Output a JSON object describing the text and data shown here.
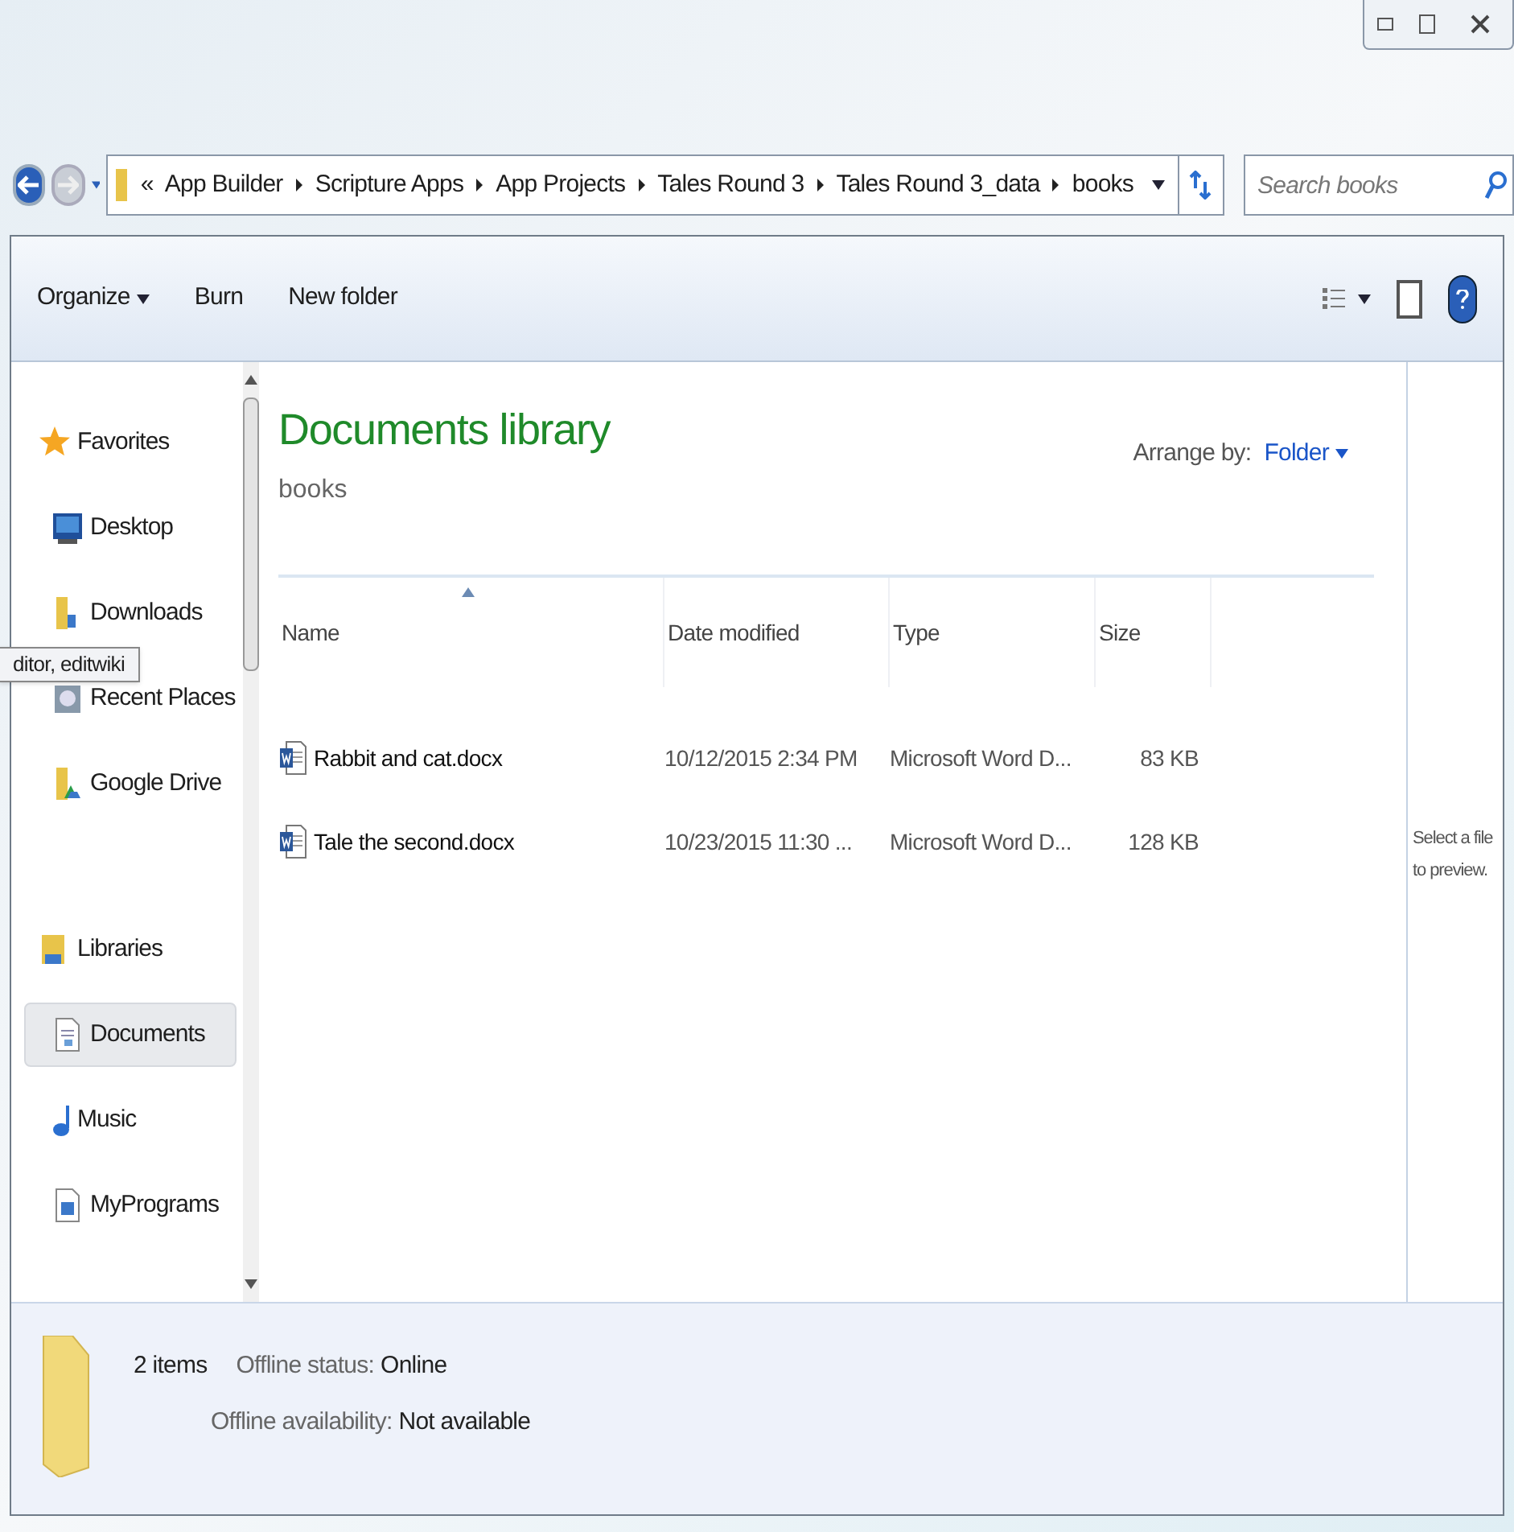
{
  "address_bar": {
    "overflow": "«",
    "segments": [
      "App Builder",
      "Scripture Apps",
      "App Projects",
      "Tales Round 3",
      "Tales Round 3_data",
      "books"
    ]
  },
  "search": {
    "placeholder": "Search books"
  },
  "toolbar": {
    "buttons": [
      {
        "label": "Organize",
        "dropdown": true
      },
      {
        "label": "Burn",
        "dropdown": false
      },
      {
        "label": "New folder",
        "dropdown": false
      }
    ]
  },
  "sidebar": {
    "items": [
      {
        "label": "Favorites",
        "kind": "group",
        "selected": false
      },
      {
        "label": "Desktop",
        "kind": "item",
        "selected": false
      },
      {
        "label": "Downloads",
        "kind": "item",
        "selected": false
      },
      {
        "label": "Recent Places",
        "kind": "item",
        "selected": false
      },
      {
        "label": "Google Drive",
        "kind": "item",
        "selected": false
      },
      {
        "label": "Libraries",
        "kind": "group",
        "selected": false
      },
      {
        "label": "Documents",
        "kind": "item",
        "selected": true
      },
      {
        "label": "Music",
        "kind": "item",
        "selected": false
      },
      {
        "label": "MyPrograms",
        "kind": "item",
        "selected": false
      }
    ]
  },
  "tooltip": "ditor, editwiki",
  "library": {
    "title": "Documents library",
    "subtitle": "books",
    "arrange_label": "Arrange by:",
    "arrange_value": "Folder"
  },
  "table": {
    "columns": [
      "Name",
      "Date modified",
      "Type",
      "Size"
    ],
    "rows": [
      [
        "Rabbit and cat.docx",
        "10/12/2015 2:34 PM",
        "Microsoft Word D...",
        "83 KB"
      ],
      [
        "Tale the second.docx",
        "10/23/2015 11:30 ...",
        "Microsoft Word D...",
        "128 KB"
      ]
    ]
  },
  "preview": {
    "lines": [
      "Select a file",
      "to preview."
    ]
  },
  "status_bar": {
    "count": "2 items",
    "fields": [
      {
        "label": "Offline status:",
        "value": "Online"
      },
      {
        "label": "Offline availability:",
        "value": "Not available"
      }
    ]
  }
}
